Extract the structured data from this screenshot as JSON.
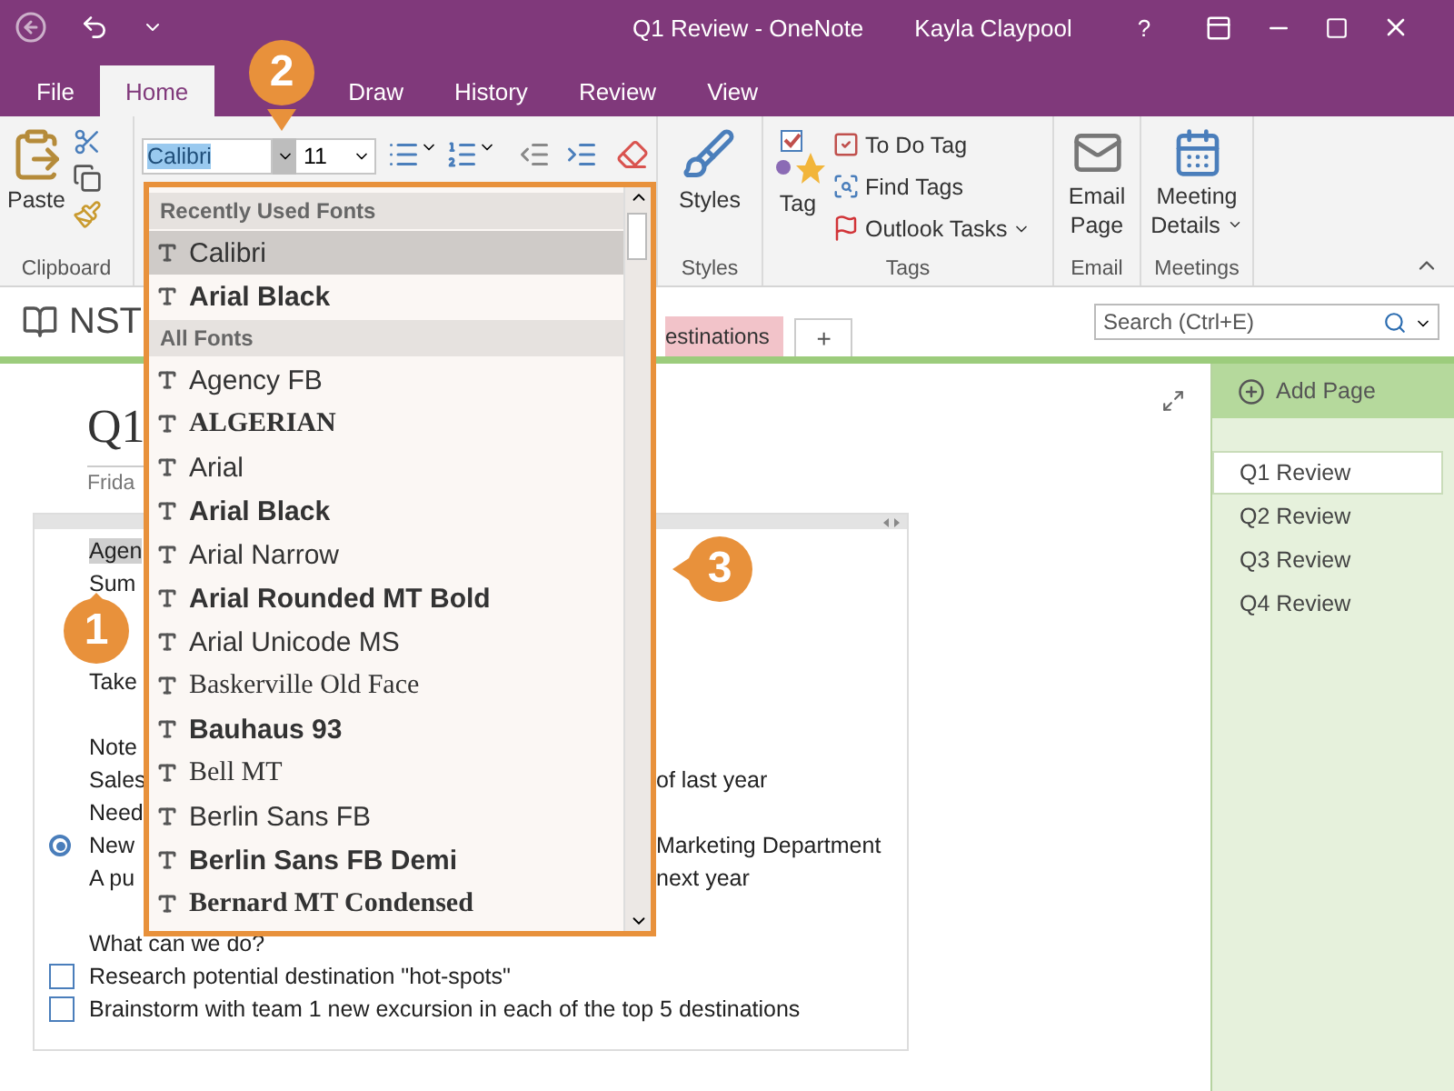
{
  "title_bar": {
    "title": "Q1 Review - OneNote",
    "user": "Kayla Claypool",
    "help": "?"
  },
  "tabs": [
    {
      "label": "File",
      "selected": false
    },
    {
      "label": "Home",
      "selected": true
    },
    {
      "label": "Draw",
      "selected": false
    },
    {
      "label": "History",
      "selected": false
    },
    {
      "label": "Review",
      "selected": false
    },
    {
      "label": "View",
      "selected": false
    }
  ],
  "ribbon": {
    "clipboard": {
      "paste": "Paste",
      "group": "Clipboard"
    },
    "font": {
      "name": "Calibri",
      "name_selected": true,
      "size": "11"
    },
    "styles": {
      "label": "Styles",
      "group": "Styles"
    },
    "tags": {
      "tag": "Tag",
      "group": "Tags",
      "items": [
        {
          "label": "To Do Tag",
          "kind": "checkbox",
          "dropdown": false
        },
        {
          "label": "Find Tags",
          "kind": "find",
          "dropdown": false
        },
        {
          "label": "Outlook Tasks",
          "kind": "flag",
          "dropdown": true
        }
      ]
    },
    "email": {
      "label": "Email Page",
      "group": "Email"
    },
    "meetings": {
      "label": "Meeting Details",
      "group": "Meetings"
    }
  },
  "notebook": {
    "name": "NST",
    "section": "estinations",
    "add_section": "+",
    "search_placeholder": "Search (Ctrl+E)"
  },
  "page": {
    "title": "Q1",
    "date": "Frida",
    "lines": [
      {
        "kind": "text",
        "left": "Agen",
        "highlighted": true
      },
      {
        "kind": "text",
        "left": "Sum",
        "highlighted": false
      },
      {
        "kind": "blank"
      },
      {
        "kind": "blank"
      },
      {
        "kind": "text",
        "left": "Take",
        "highlighted": false
      },
      {
        "kind": "blank"
      },
      {
        "kind": "text",
        "left": "Note",
        "highlighted": false
      },
      {
        "kind": "text",
        "left": "Sales",
        "right": "of last year",
        "highlighted": false
      },
      {
        "kind": "text",
        "left": "Need",
        "highlighted": false
      },
      {
        "kind": "tagged",
        "left": "New",
        "right": "Marketing Department",
        "highlighted": false
      },
      {
        "kind": "text",
        "left": "A pu",
        "right": "next year",
        "highlighted": false
      },
      {
        "kind": "blank"
      },
      {
        "kind": "text",
        "left": "What can we do?",
        "highlighted": false
      },
      {
        "kind": "todo",
        "left": "Research potential destination \"hot-spots\"",
        "checked": false,
        "highlighted": false
      },
      {
        "kind": "todo",
        "left": "Brainstorm with team 1 new excursion in each of the top 5 destinations",
        "checked": false,
        "highlighted": false
      }
    ]
  },
  "pages": {
    "add": "Add Page",
    "items": [
      {
        "label": "Q1 Review",
        "selected": true
      },
      {
        "label": "Q2 Review",
        "selected": false
      },
      {
        "label": "Q3 Review",
        "selected": false
      },
      {
        "label": "Q4 Review",
        "selected": false
      }
    ]
  },
  "font_dropdown": {
    "groups": [
      {
        "header": "Recently Used Fonts",
        "fonts": [
          {
            "name": "Calibri",
            "selected": true,
            "bold": false,
            "serif": false
          },
          {
            "name": "Arial Black",
            "selected": false,
            "bold": true,
            "serif": false
          }
        ]
      },
      {
        "header": "All Fonts",
        "fonts": [
          {
            "name": "Agency FB",
            "selected": false,
            "bold": false,
            "serif": false
          },
          {
            "name": "ALGERIAN",
            "selected": false,
            "bold": true,
            "serif": true
          },
          {
            "name": "Arial",
            "selected": false,
            "bold": false,
            "serif": false
          },
          {
            "name": "Arial Black",
            "selected": false,
            "bold": true,
            "serif": false
          },
          {
            "name": "Arial Narrow",
            "selected": false,
            "bold": false,
            "serif": false
          },
          {
            "name": "Arial Rounded MT Bold",
            "selected": false,
            "bold": true,
            "serif": false
          },
          {
            "name": "Arial Unicode MS",
            "selected": false,
            "bold": false,
            "serif": false
          },
          {
            "name": "Baskerville Old Face",
            "selected": false,
            "bold": false,
            "serif": true
          },
          {
            "name": "Bauhaus 93",
            "selected": false,
            "bold": true,
            "serif": false
          },
          {
            "name": "Bell MT",
            "selected": false,
            "bold": false,
            "serif": true
          },
          {
            "name": "Berlin Sans FB",
            "selected": false,
            "bold": false,
            "serif": false
          },
          {
            "name": "Berlin Sans FB Demi",
            "selected": false,
            "bold": true,
            "serif": false
          },
          {
            "name": "Bernard MT Condensed",
            "selected": false,
            "bold": true,
            "serif": true
          }
        ]
      }
    ]
  },
  "callouts": [
    "1",
    "2",
    "3"
  ]
}
